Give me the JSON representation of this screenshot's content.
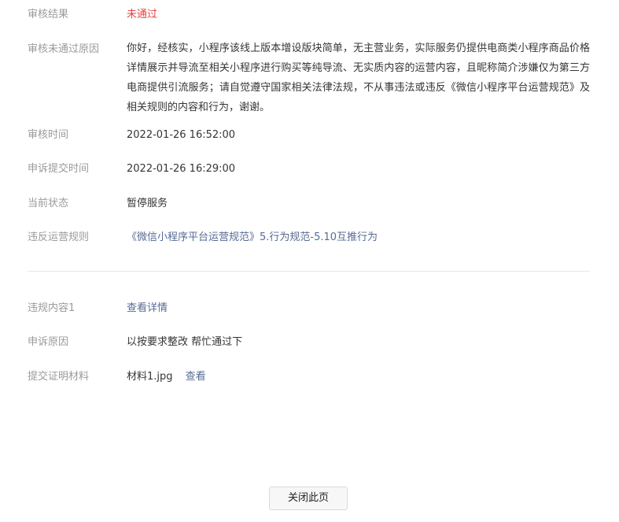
{
  "review": {
    "result_label": "审核结果",
    "result_value": "未通过",
    "reason_label": "审核未通过原因",
    "reason_value": "你好，经核实，小程序该线上版本增设版块简单，无主营业务，实际服务仍提供电商类小程序商品价格详情展示并导流至相关小程序进行购买等纯导流、无实质内容的运营内容，且昵称简介涉嫌仅为第三方电商提供引流服务；请自觉遵守国家相关法律法规，不从事违法或违反《微信小程序平台运营规范》及相关规则的内容和行为，谢谢。",
    "time_label": "审核时间",
    "time_value": "2022-01-26 16:52:00",
    "appeal_time_label": "申诉提交时间",
    "appeal_time_value": "2022-01-26 16:29:00",
    "status_label": "当前状态",
    "status_value": "暂停服务",
    "rule_label": "违反运营规则",
    "rule_value": "《微信小程序平台运营规范》5.行为规范-5.10互推行为"
  },
  "appeal": {
    "content_label": "违规内容1",
    "content_link": "查看详情",
    "reason_label": "申诉原因",
    "reason_value": "以按要求整改 帮忙通过下",
    "material_label": "提交证明材料",
    "material_file": "材料1.jpg",
    "material_view": "查看"
  },
  "footer": {
    "close_label": "关闭此页"
  },
  "colors": {
    "label": "#9a9a9a",
    "text": "#353535",
    "fail_red": "#e64340",
    "link_blue": "#576b95",
    "divider": "#e7e7eb"
  }
}
